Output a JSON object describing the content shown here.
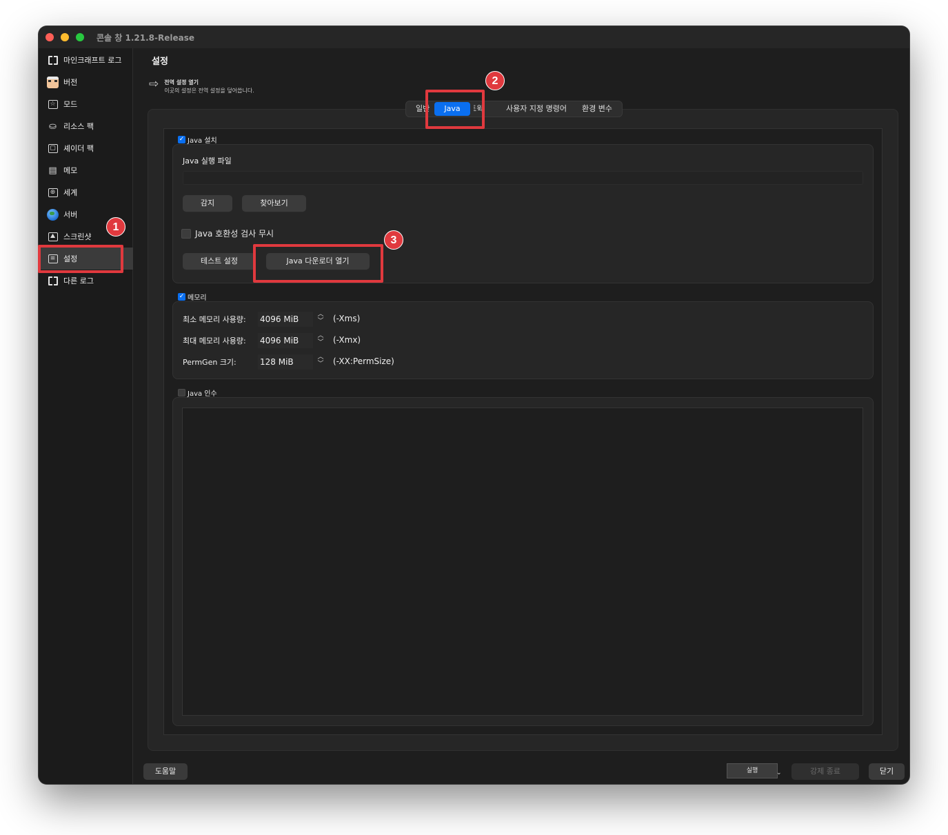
{
  "window": {
    "title": "콘솔 창 1.21.8-Release"
  },
  "sidebar": {
    "items": [
      {
        "label": "마인크래프트 로그",
        "icon": "book-icon"
      },
      {
        "label": "버전",
        "icon": "face-icon"
      },
      {
        "label": "모드",
        "icon": "star-box-icon"
      },
      {
        "label": "리소스 팩",
        "icon": "package-icon"
      },
      {
        "label": "셰이더 팩",
        "icon": "cube-icon"
      },
      {
        "label": "메모",
        "icon": "clipboard-icon"
      },
      {
        "label": "세계",
        "icon": "world-icon"
      },
      {
        "label": "서버",
        "icon": "globe-icon"
      },
      {
        "label": "스크린샷",
        "icon": "image-icon"
      },
      {
        "label": "설정",
        "icon": "settings-icon",
        "active": true
      },
      {
        "label": "다른 로그",
        "icon": "book-icon"
      }
    ]
  },
  "page": {
    "title": "설정",
    "global_link_title": "전역 설정 열기",
    "global_link_desc": "이곳의 설정은 전역 설정을 덮어씁니다."
  },
  "tabs": [
    {
      "label": "일반"
    },
    {
      "label": "Java",
      "active": true
    },
    {
      "label": "트윅"
    },
    {
      "label": "사용자 지정 명령어"
    },
    {
      "label": "환경 변수"
    }
  ],
  "java_install": {
    "checkbox_label": "Java 설치",
    "checked": true,
    "executable_label": "Java 실행 파일",
    "executable_path": "",
    "detect_button": "감지",
    "browse_button": "찾아보기",
    "ignore_compat_label": "Java 호환성 검사 무시",
    "ignore_compat_checked": false,
    "test_button": "테스트 설정",
    "downloader_button": "Java 다운로더 열기"
  },
  "memory": {
    "checkbox_label": "메모리",
    "checked": true,
    "rows": [
      {
        "label": "최소 메모리 사용량:",
        "value": "4096 MiB",
        "flag": "(-Xms)"
      },
      {
        "label": "최대 메모리 사용량:",
        "value": "4096 MiB",
        "flag": "(-Xmx)"
      },
      {
        "label": "PermGen 크기:",
        "value": "128 MiB",
        "flag": "(-XX:PermSize)"
      }
    ]
  },
  "java_args": {
    "checkbox_label": "Java 인수",
    "checked": false,
    "value": ""
  },
  "footer": {
    "help_button": "도움말",
    "launch_button": "실행",
    "kill_button": "강제 종료",
    "close_button": "닫기"
  },
  "annotations": [
    {
      "number": "1",
      "target": "설정"
    },
    {
      "number": "2",
      "target": "Java"
    },
    {
      "number": "3",
      "target": "Java 다운로더 열기"
    }
  ],
  "colors": {
    "accent": "#0a6ff0",
    "highlight": "#e0393e",
    "background": "#1e1e1e"
  }
}
